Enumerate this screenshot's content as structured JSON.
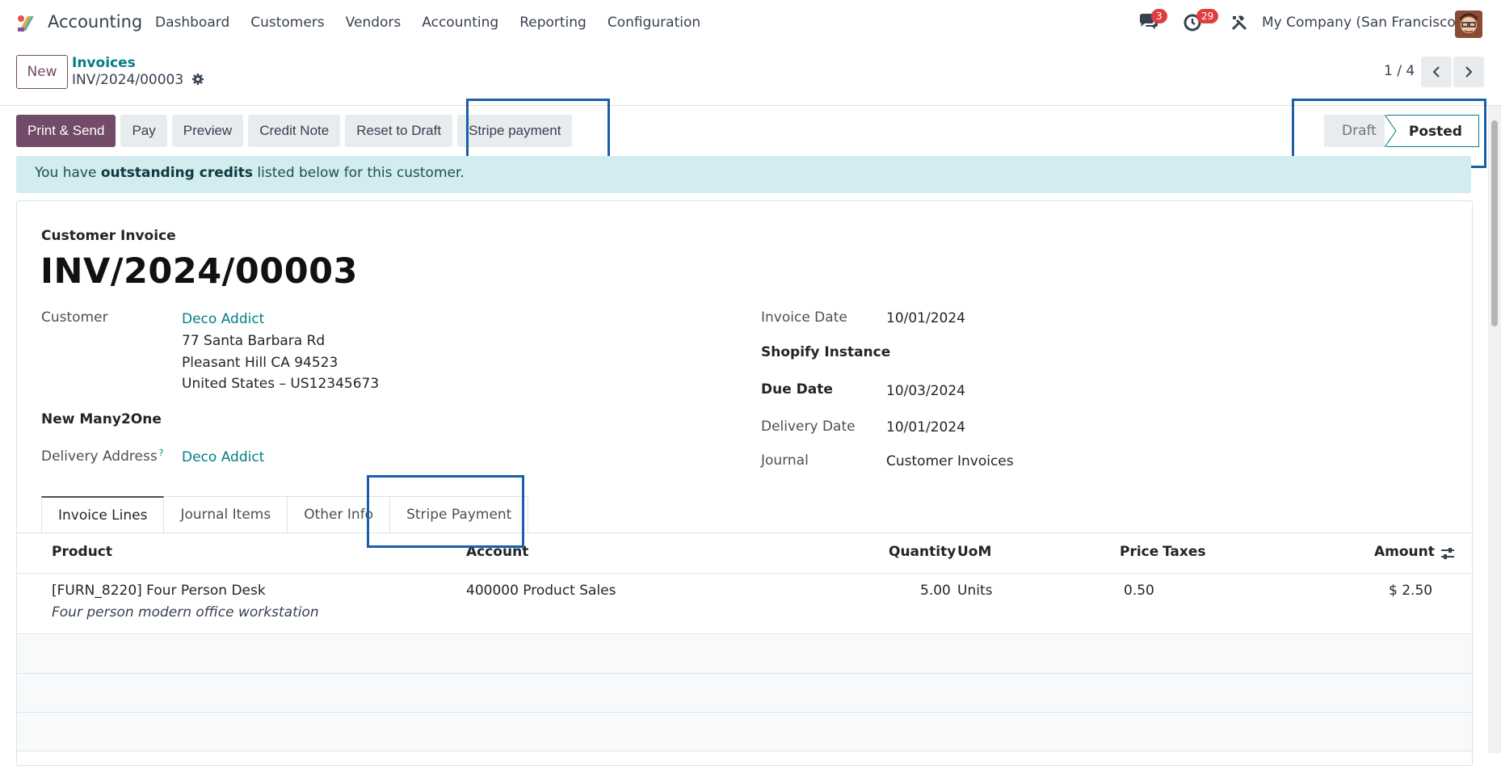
{
  "navbar": {
    "app_name": "Accounting",
    "menu": [
      "Dashboard",
      "Customers",
      "Vendors",
      "Accounting",
      "Reporting",
      "Configuration"
    ],
    "messages_badge": "3",
    "activities_badge": "29",
    "company": "My Company (San Francisco)"
  },
  "control_panel": {
    "new_label": "New",
    "breadcrumb": "Invoices",
    "record_name": "INV/2024/00003",
    "pager": "1 / 4"
  },
  "actions": {
    "print_send": "Print & Send",
    "pay": "Pay",
    "preview": "Preview",
    "credit_note": "Credit Note",
    "reset_to_draft": "Reset to Draft",
    "stripe_payment": "Stripe payment"
  },
  "statusbar": {
    "draft": "Draft",
    "posted": "Posted"
  },
  "alert": {
    "prefix": "You have ",
    "bold": "outstanding credits",
    "suffix": " listed below for this customer."
  },
  "invoice": {
    "type": "Customer Invoice",
    "name": "INV/2024/00003",
    "customer_label": "Customer",
    "customer": "Deco Addict",
    "address_line1": "77 Santa Barbara Rd",
    "address_line2": "Pleasant Hill CA 94523",
    "address_line3": "United States – US12345673",
    "new_many2one_label": "New Many2One",
    "delivery_address_label": "Delivery Address",
    "delivery_address_help": "?",
    "delivery_address": "Deco Addict",
    "invoice_date_label": "Invoice Date",
    "invoice_date": "10/01/2024",
    "shopify_label": "Shopify Instance",
    "due_date_label": "Due Date",
    "due_date": "10/03/2024",
    "delivery_date_label": "Delivery Date",
    "delivery_date": "10/01/2024",
    "journal_label": "Journal",
    "journal": "Customer Invoices"
  },
  "tabs": [
    "Invoice Lines",
    "Journal Items",
    "Other Info",
    "Stripe Payment"
  ],
  "lines": {
    "headers": {
      "product": "Product",
      "account": "Account",
      "quantity": "Quantity",
      "uom": "UoM",
      "price": "Price",
      "taxes": "Taxes",
      "amount": "Amount"
    },
    "rows": [
      {
        "product": "[FURN_8220] Four Person Desk",
        "description": "Four person modern office workstation",
        "account": "400000 Product Sales",
        "quantity": "5.00",
        "uom": "Units",
        "price": "0.50",
        "taxes": "",
        "amount": "$ 2.50"
      }
    ]
  },
  "colors": {
    "brand": "#714b67",
    "link": "#017e84",
    "highlight_box": "#1a5fa8",
    "alert_bg": "#d2ecef"
  }
}
